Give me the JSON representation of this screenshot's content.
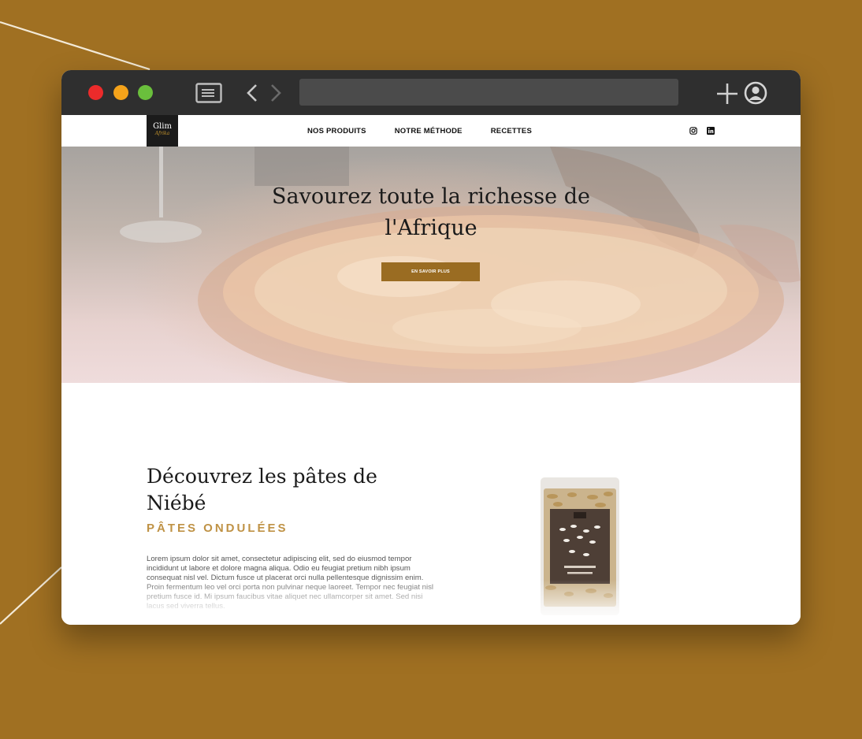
{
  "site": {
    "logo_line1": "Glim",
    "logo_line2": "Afrika"
  },
  "nav": {
    "items": [
      {
        "label": "NOS PRODUITS"
      },
      {
        "label": "NOTRE MÉTHODE"
      },
      {
        "label": "RECETTES"
      }
    ]
  },
  "social": {
    "icons": [
      "instagram-icon",
      "linkedin-icon"
    ]
  },
  "hero": {
    "title_line1": "Savourez toute la richesse de",
    "title_line2": "l'Afrique",
    "cta_label": "EN SAVOIR PLUS"
  },
  "product": {
    "title_line1": "Découvrez les pâtes de",
    "title_line2": "Niébé",
    "subtitle": "PÂTES ONDULÉES",
    "description": "Lorem ipsum dolor sit amet, consectetur adipiscing elit, sed do eiusmod tempor incididunt ut labore et dolore magna aliqua. Odio eu feugiat pretium nibh ipsum consequat nisl vel. Dictum fusce ut placerat orci nulla pellentesque dignissim enim. Proin fermentum leo vel orci porta non pulvinar neque laoreet. Tempor nec feugiat nisl pretium fusce id. Mi ipsum faucibus vitae aliquet nec ullamcorper sit amet. Sed nisi lacus sed viverra tellus."
  },
  "colors": {
    "background": "#a07022",
    "titlebar": "#2f2f2f",
    "accent": "#9a6c22",
    "subtitle": "#bf9245"
  }
}
